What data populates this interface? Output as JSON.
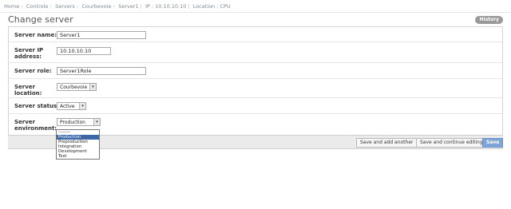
{
  "breadcrumbs": [
    "Home",
    "Controle",
    "Servers",
    "Courbevoie",
    "Server1",
    "IP : 10.10.10.10",
    "Location : CPU"
  ],
  "page": {
    "title": "Change server",
    "history_label": "History"
  },
  "fields": {
    "server_name": {
      "label": "Server name:",
      "value": "Server1"
    },
    "server_ip": {
      "label": "Server IP address:",
      "value": "10.10.10.10"
    },
    "server_role": {
      "label": "Server role:",
      "value": "Server1Role"
    },
    "server_location": {
      "label": "Server location:",
      "value": "Courbevoie"
    },
    "server_status": {
      "label": "Server status:",
      "value": "Active"
    },
    "server_environment": {
      "label": "Server environment:",
      "value": "Production",
      "options": [
        "--------",
        "Production",
        "Preproduction",
        "Integration",
        "Development",
        "Test"
      ],
      "highlighted_index": 1
    }
  },
  "buttons": {
    "save_add_another": "Save and add another",
    "save_continue": "Save and continue editing",
    "save": "Save"
  }
}
